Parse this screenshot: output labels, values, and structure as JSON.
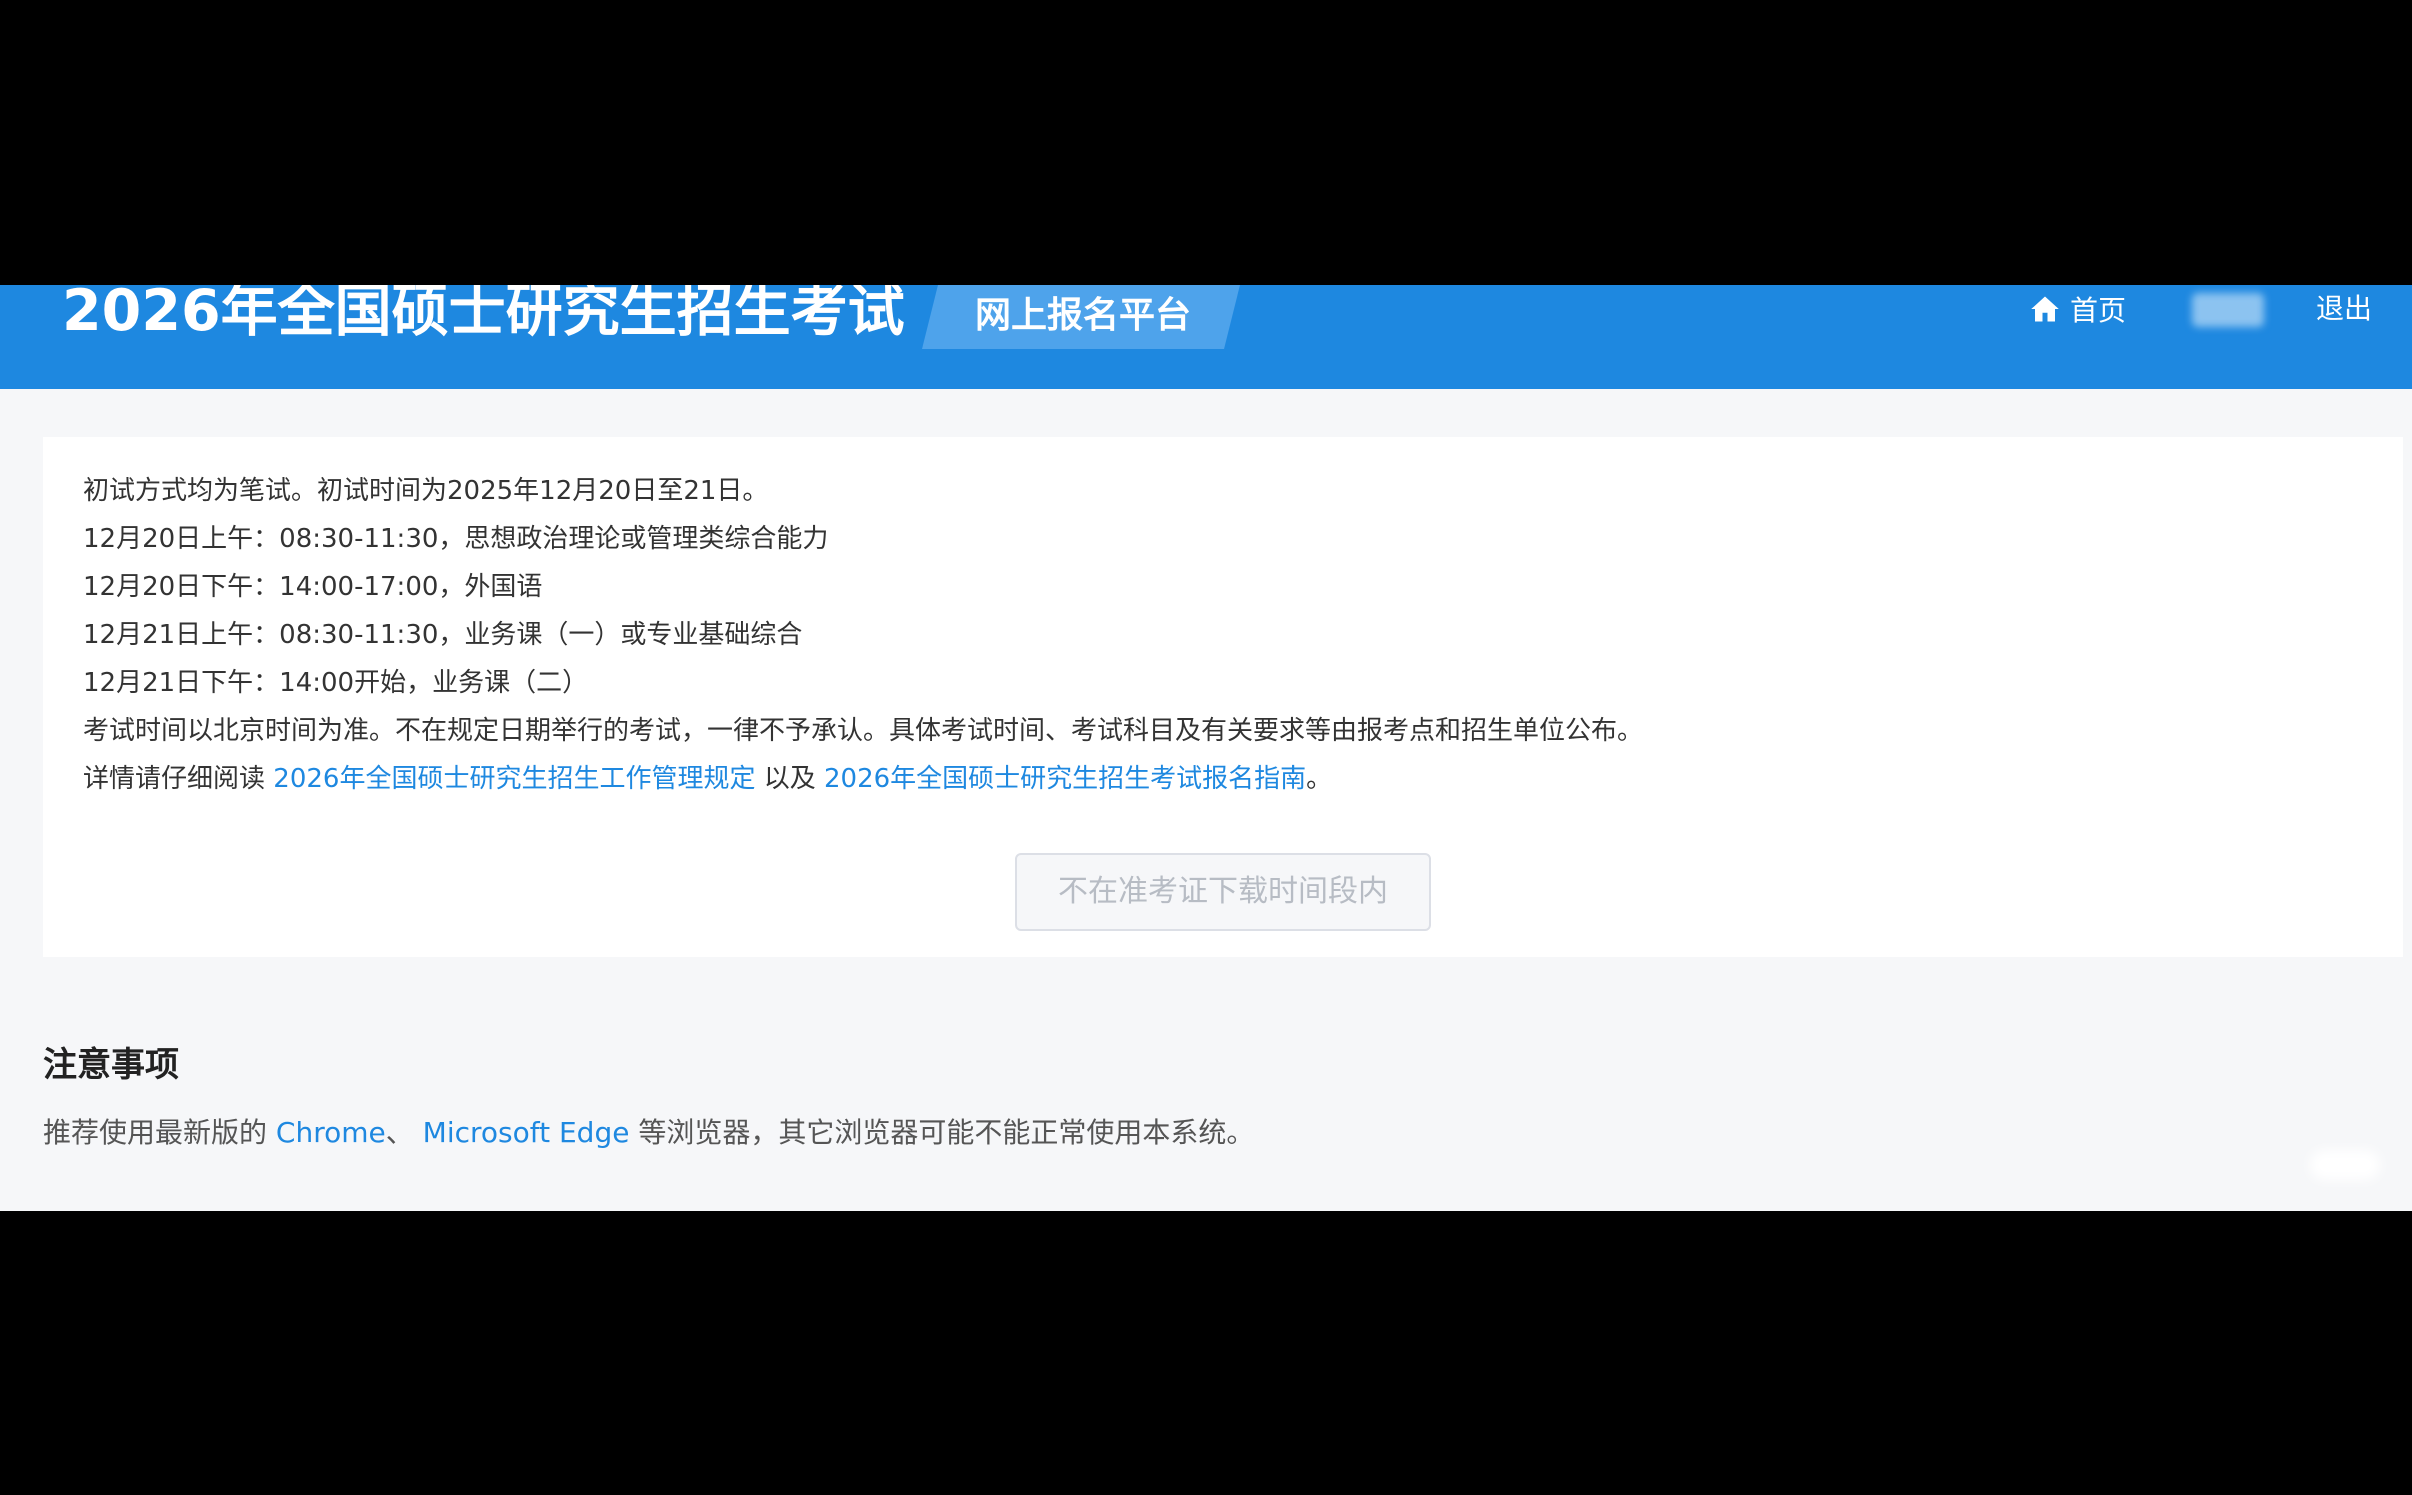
{
  "header": {
    "title": "2026年全国硕士研究生招生考试",
    "platform": "网上报名平台",
    "nav": {
      "home": "首页",
      "logout": "退出"
    },
    "colors": {
      "bar": "#1e88e0",
      "badge": "#4ea3eb"
    }
  },
  "exam_info": {
    "lines": [
      "初试方式均为笔试。初试时间为2025年12月20日至21日。",
      "12月20日上午：08:30-11:30，思想政治理论或管理类综合能力",
      "12月20日下午：14:00-17:00，外国语",
      "12月21日上午：08:30-11:30，业务课（一）或专业基础综合",
      "12月21日下午：14:00开始，业务课（二）",
      "考试时间以北京时间为准。不在规定日期举行的考试，一律不予承认。具体考试时间、考试科目及有关要求等由报考点和招生单位公布。"
    ],
    "details_prefix": "详情请仔细阅读",
    "link_regulations": "2026年全国硕士研究生招生工作管理规定",
    "connector": "以及",
    "link_guide": "2026年全国硕士研究生招生考试报名指南",
    "details_suffix": "。",
    "download_button": "不在准考证下载时间段内"
  },
  "notice": {
    "title": "注意事项",
    "prefix": "推荐使用最新版的",
    "browser_chrome": "Chrome",
    "separator": "、",
    "browser_edge": "Microsoft Edge",
    "suffix": "等浏览器，其它浏览器可能不能正常使用本系统。"
  },
  "icons": {
    "home": "home-icon"
  }
}
